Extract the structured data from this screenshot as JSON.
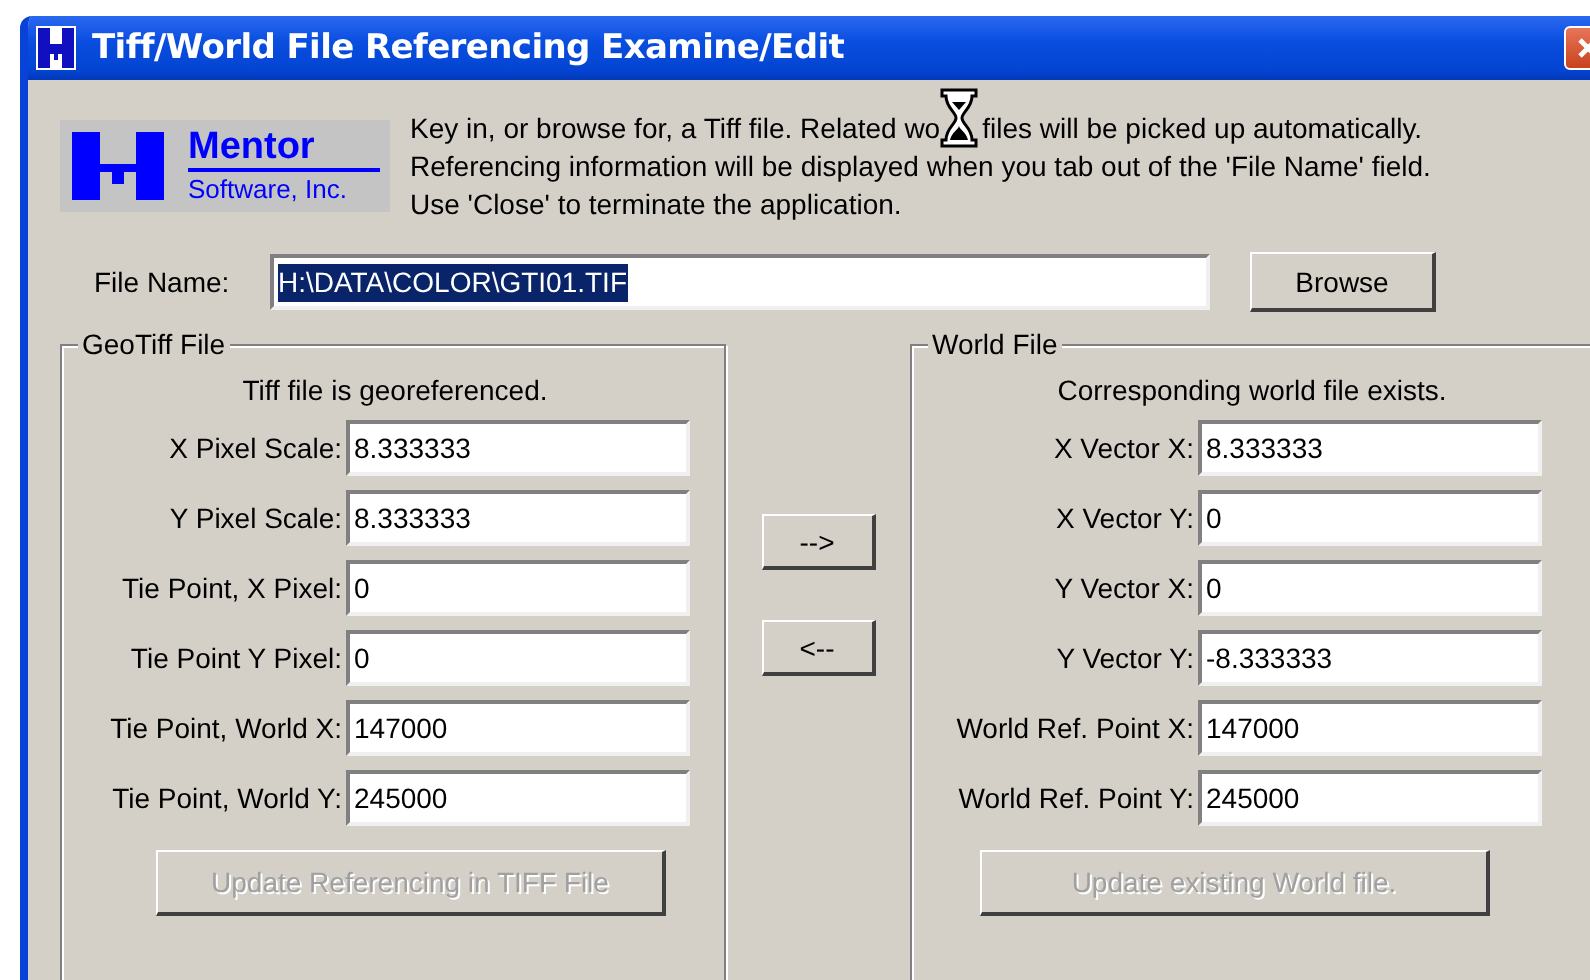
{
  "window": {
    "title": "Tiff/World File Referencing Examine/Edit"
  },
  "logo": {
    "name": "Mentor",
    "subtitle": "Software, Inc."
  },
  "instructions": {
    "line_1_before": "Key in, or browse for, a Tiff file.  Related wo",
    "line_1_after": "files will be picked up automatically.",
    "line_2": "Referencing information will be displayed when you tab out of the 'File Name' field.",
    "line_3": "Use 'Close' to terminate the application."
  },
  "file_name": {
    "label": "File Name:",
    "value": "H:\\DATA\\COLOR\\GTI01.TIF",
    "selected": true
  },
  "browse_button": {
    "label": "Browse"
  },
  "geotiff": {
    "title": "GeoTiff File",
    "status": "Tiff file is georeferenced.",
    "fields": [
      {
        "label": "X Pixel Scale:",
        "value": "8.333333"
      },
      {
        "label": "Y Pixel Scale:",
        "value": "8.333333"
      },
      {
        "label": "Tie Point, X Pixel:",
        "value": "0"
      },
      {
        "label": "Tie Point Y Pixel:",
        "value": "0"
      },
      {
        "label": "Tie Point, World X:",
        "value": "147000"
      },
      {
        "label": "Tie Point, World Y:",
        "value": "245000"
      }
    ],
    "update_button": {
      "label": "Update Referencing in TIFF File",
      "disabled": true
    }
  },
  "transfer_buttons": [
    {
      "label": "-->"
    },
    {
      "label": "<--"
    }
  ],
  "world_file": {
    "title": "World File",
    "status": "Corresponding world file exists.",
    "fields": [
      {
        "label": "X Vector X:",
        "value": "8.333333"
      },
      {
        "label": "X Vector Y:",
        "value": "0"
      },
      {
        "label": "Y Vector X:",
        "value": "0"
      },
      {
        "label": "Y Vector Y:",
        "value": "-8.333333"
      },
      {
        "label": "World Ref. Point X:",
        "value": "147000"
      },
      {
        "label": "World Ref. Point Y:",
        "value": "245000"
      }
    ],
    "update_button": {
      "label": "Update existing World file.",
      "disabled": true
    }
  }
}
